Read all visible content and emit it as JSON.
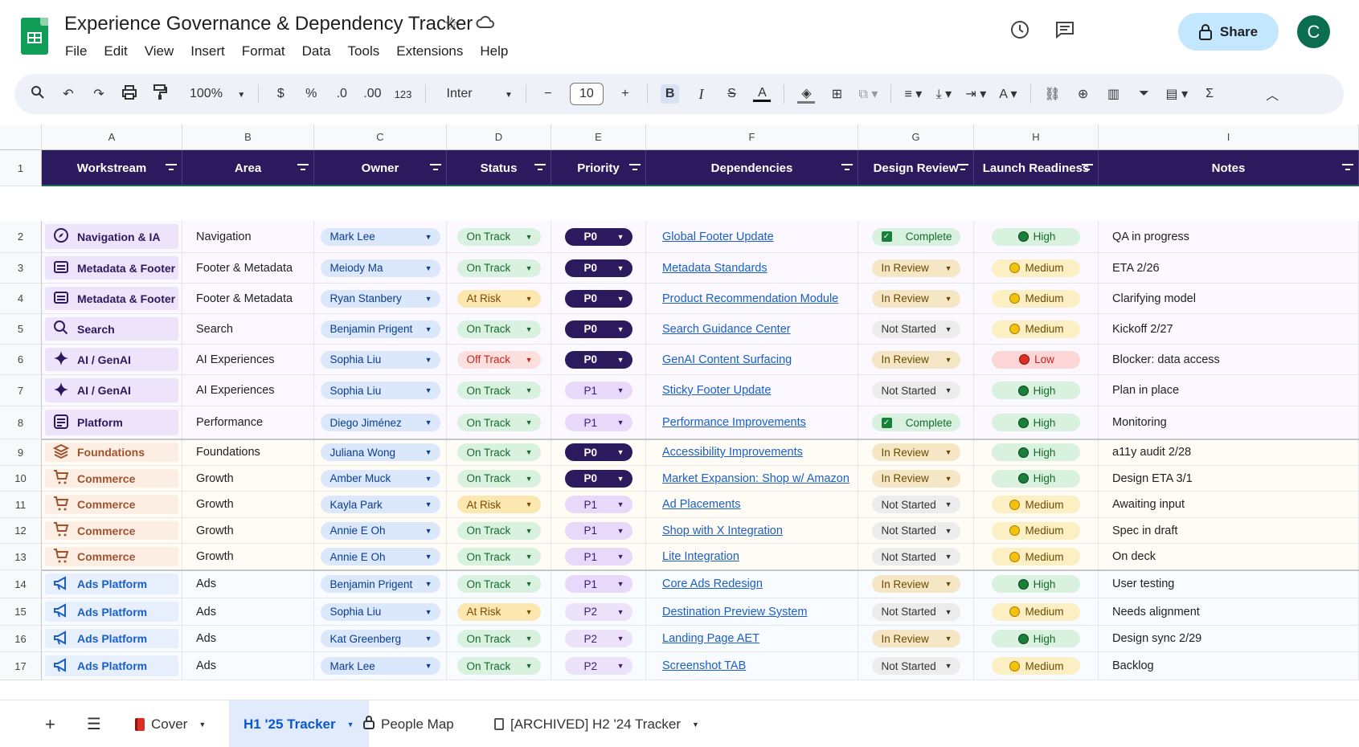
{
  "app": {
    "title": "Experience Governance & Dependency Tracker",
    "menu": [
      "File",
      "Edit",
      "View",
      "Insert",
      "Format",
      "Data",
      "Tools",
      "Extensions",
      "Help"
    ],
    "share_label": "Share",
    "avatar_initial": "C"
  },
  "toolbar": {
    "zoom": "100%",
    "currency": "$",
    "percent": "%",
    "dec_decrease": ".0",
    "dec_increase": ".00",
    "number_format": "123",
    "font": "Inter",
    "font_size": "10",
    "bold": "B",
    "italic": "I"
  },
  "columns": [
    "A",
    "B",
    "C",
    "D",
    "E",
    "F",
    "G",
    "H",
    "I"
  ],
  "headers": [
    "Workstream",
    "Area",
    "Owner",
    "Status",
    "Priority",
    "Dependencies",
    "Design Review",
    "Launch Readiness",
    "Notes"
  ],
  "rows": [
    {
      "n": "2",
      "ws": "Navigation & IA",
      "icon": "compass",
      "area": "Navigation",
      "owner": "Mark Lee",
      "status": "On Track",
      "priority": "P0",
      "dep": "Global Footer Update",
      "review": "Complete",
      "ready": "High",
      "notes": "QA in progress",
      "group": "a"
    },
    {
      "n": "3",
      "ws": "Metadata & Footer",
      "icon": "folder",
      "area": "Footer & Metadata",
      "owner": "Meiody Ma",
      "status": "On Track",
      "priority": "P0",
      "dep": "Metadata Standards",
      "review": "In Review",
      "ready": "Medium",
      "notes": "ETA 2/26",
      "group": "a"
    },
    {
      "n": "4",
      "ws": "Metadata & Footer",
      "icon": "folder",
      "area": "Footer & Metadata",
      "owner": "Ryan Stanbery",
      "status": "At Risk",
      "priority": "P0",
      "dep": "Product Recommendation Module",
      "review": "In Review",
      "ready": "Medium",
      "notes": "Clarifying model",
      "group": "a"
    },
    {
      "n": "5",
      "ws": "Search",
      "icon": "search",
      "area": "Search",
      "owner": "Benjamin Prigent",
      "status": "On Track",
      "priority": "P0",
      "dep": "Search Guidance Center",
      "review": "Not Started",
      "ready": "Medium",
      "notes": "Kickoff 2/27",
      "group": "a"
    },
    {
      "n": "6",
      "ws": "AI / GenAI",
      "icon": "sparkle",
      "area": "AI Experiences",
      "owner": "Sophia Liu",
      "status": "Off Track",
      "priority": "P0",
      "dep": "GenAI Content Surfacing",
      "review": "In Review",
      "ready": "Low",
      "notes": "Blocker: data access",
      "group": "a"
    },
    {
      "n": "7",
      "ws": "AI / GenAI",
      "icon": "sparkle",
      "area": "AI Experiences",
      "owner": "Sophia Liu",
      "status": "On Track",
      "priority": "P1",
      "dep": "Sticky Footer Update",
      "review": "Not Started",
      "ready": "High",
      "notes": "Plan in place",
      "group": "a"
    },
    {
      "n": "8",
      "ws": "Platform",
      "icon": "platform",
      "area": "Performance",
      "owner": "Diego Jiménez",
      "status": "On Track",
      "priority": "P1",
      "dep": "Performance Improvements",
      "review": "Complete",
      "ready": "High",
      "notes": "Monitoring",
      "group": "a"
    },
    {
      "n": "9",
      "ws": "Foundations",
      "icon": "layers",
      "area": "Foundations",
      "owner": "Juliana Wong",
      "status": "On Track",
      "priority": "P0",
      "dep": "Accessibility Improvements",
      "review": "In Review",
      "ready": "High",
      "notes": "a11y audit 2/28",
      "group": "b"
    },
    {
      "n": "10",
      "ws": "Commerce",
      "icon": "cart",
      "area": "Growth",
      "owner": "Amber Muck",
      "status": "On Track",
      "priority": "P0",
      "dep": "Market Expansion: Shop w/ Amazon",
      "review": "In Review",
      "ready": "High",
      "notes": "Design ETA 3/1",
      "group": "b"
    },
    {
      "n": "11",
      "ws": "Commerce",
      "icon": "cart",
      "area": "Growth",
      "owner": "Kayla Park",
      "status": "At Risk",
      "priority": "P1",
      "dep": "Ad Placements",
      "review": "Not Started",
      "ready": "Medium",
      "notes": "Awaiting input",
      "group": "b"
    },
    {
      "n": "12",
      "ws": "Commerce",
      "icon": "cart",
      "area": "Growth",
      "owner": "Annie E Oh",
      "status": "On Track",
      "priority": "P1",
      "dep": "Shop with X Integration",
      "review": "Not Started",
      "ready": "Medium",
      "notes": "Spec in draft",
      "group": "b"
    },
    {
      "n": "13",
      "ws": "Commerce",
      "icon": "cart",
      "area": "Growth",
      "owner": "Annie E Oh",
      "status": "On Track",
      "priority": "P1",
      "dep": "Lite Integration",
      "review": "Not Started",
      "ready": "Medium",
      "notes": "On deck",
      "group": "b"
    },
    {
      "n": "14",
      "ws": "Ads Platform",
      "icon": "megaphone",
      "area": "Ads",
      "owner": "Benjamin Prigent",
      "status": "On Track",
      "priority": "P1",
      "dep": "Core Ads Redesign",
      "review": "In Review",
      "ready": "High",
      "notes": "User testing",
      "group": "c"
    },
    {
      "n": "15",
      "ws": "Ads Platform",
      "icon": "megaphone",
      "area": "Ads",
      "owner": "Sophia Liu",
      "status": "At Risk",
      "priority": "P2",
      "dep": "Destination Preview System",
      "review": "Not Started",
      "ready": "Medium",
      "notes": "Needs alignment",
      "group": "c"
    },
    {
      "n": "16",
      "ws": "Ads Platform",
      "icon": "megaphone",
      "area": "Ads",
      "owner": "Kat Greenberg",
      "status": "On Track",
      "priority": "P2",
      "dep": "Landing Page AET",
      "review": "In Review",
      "ready": "High",
      "notes": "Design sync 2/29",
      "group": "c"
    },
    {
      "n": "17",
      "ws": "Ads Platform",
      "icon": "megaphone",
      "area": "Ads",
      "owner": "Mark Lee",
      "status": "On Track",
      "priority": "P2",
      "dep": "Screenshot TAB",
      "review": "Not Started",
      "ready": "Medium",
      "notes": "Backlog",
      "group": "c"
    }
  ],
  "header_row_number": "1",
  "sheet_tabs": [
    {
      "label": "Cover",
      "icon": "book"
    },
    {
      "label": "H1 '25 Tracker",
      "icon": "",
      "active": true
    },
    {
      "label": "People Map",
      "icon": "lock"
    },
    {
      "label": "[ARCHIVED] H2 '24 Tracker",
      "icon": "archive"
    }
  ],
  "colors": {
    "header_bg": "#2b1b5e",
    "group_a": "#ede4fb",
    "group_b": "#fdeee4",
    "group_c": "#e6effb",
    "accent": "#c2e7ff"
  }
}
